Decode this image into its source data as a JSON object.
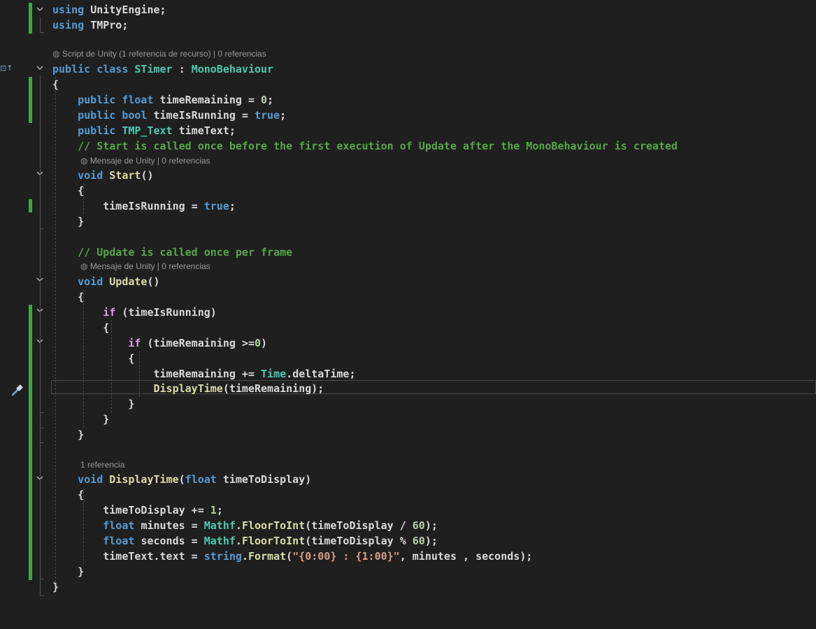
{
  "gutter": {
    "hierarchy_marker": "⊡↑"
  },
  "lenses": {
    "class_lens": "Script de Unity (1 referencia de recurso) | 0 referencias",
    "start_lens": "Mensaje de Unity | 0 referencias",
    "update_lens": "Mensaje de Unity | 0 referencias",
    "display_lens": "1 referencia"
  },
  "lines": {
    "l1": [
      [
        "using",
        "kw"
      ],
      [
        " ",
        "op"
      ],
      [
        "UnityEngine",
        "id"
      ],
      [
        ";",
        "op"
      ]
    ],
    "l2": [
      [
        "using",
        "kw"
      ],
      [
        " ",
        "op"
      ],
      [
        "TMPro",
        "id"
      ],
      [
        ";",
        "op"
      ]
    ],
    "l3": [
      [
        "public",
        "kw"
      ],
      [
        " ",
        "op"
      ],
      [
        "class",
        "kw"
      ],
      [
        " ",
        "op"
      ],
      [
        "STimer",
        "ty"
      ],
      [
        " : ",
        "op"
      ],
      [
        "MonoBehaviour",
        "ty"
      ]
    ],
    "l4": [
      [
        "{",
        "op"
      ]
    ],
    "l5": [
      [
        "    ",
        "op"
      ],
      [
        "public",
        "kw"
      ],
      [
        " ",
        "op"
      ],
      [
        "float",
        "kw"
      ],
      [
        " ",
        "op"
      ],
      [
        "timeRemaining",
        "id"
      ],
      [
        " = ",
        "op"
      ],
      [
        "0",
        "nm"
      ],
      [
        ";",
        "op"
      ]
    ],
    "l6": [
      [
        "    ",
        "op"
      ],
      [
        "public",
        "kw"
      ],
      [
        " ",
        "op"
      ],
      [
        "bool",
        "kw"
      ],
      [
        " ",
        "op"
      ],
      [
        "timeIsRunning",
        "id"
      ],
      [
        " = ",
        "op"
      ],
      [
        "true",
        "kw"
      ],
      [
        ";",
        "op"
      ]
    ],
    "l7": [
      [
        "    ",
        "op"
      ],
      [
        "public",
        "kw"
      ],
      [
        " ",
        "op"
      ],
      [
        "TMP_Text",
        "ty"
      ],
      [
        " ",
        "op"
      ],
      [
        "timeText",
        "id"
      ],
      [
        ";",
        "op"
      ]
    ],
    "l8": [
      [
        "    ",
        "op"
      ],
      [
        "// Start is called once before the first execution of Update after the MonoBehaviour is created",
        "cm"
      ]
    ],
    "l9": [
      [
        "    ",
        "op"
      ],
      [
        "void",
        "kw"
      ],
      [
        " ",
        "op"
      ],
      [
        "Start",
        "fn"
      ],
      [
        "()",
        "op"
      ]
    ],
    "l10": [
      [
        "    ",
        "op"
      ],
      [
        "{",
        "op"
      ]
    ],
    "l11": [
      [
        "        ",
        "op"
      ],
      [
        "timeIsRunning",
        "id"
      ],
      [
        " = ",
        "op"
      ],
      [
        "true",
        "kw"
      ],
      [
        ";",
        "op"
      ]
    ],
    "l12": [
      [
        "    ",
        "op"
      ],
      [
        "}",
        "op"
      ]
    ],
    "l13": [
      [
        "    ",
        "op"
      ],
      [
        "// Update is called once per frame",
        "cm"
      ]
    ],
    "l14": [
      [
        "    ",
        "op"
      ],
      [
        "void",
        "kw"
      ],
      [
        " ",
        "op"
      ],
      [
        "Update",
        "fn"
      ],
      [
        "()",
        "op"
      ]
    ],
    "l15": [
      [
        "    ",
        "op"
      ],
      [
        "{",
        "op"
      ]
    ],
    "l16": [
      [
        "        ",
        "op"
      ],
      [
        "if",
        "ct"
      ],
      [
        " (",
        "op"
      ],
      [
        "timeIsRunning",
        "id"
      ],
      [
        ")",
        "op"
      ]
    ],
    "l17": [
      [
        "        ",
        "op"
      ],
      [
        "{",
        "op"
      ]
    ],
    "l18": [
      [
        "            ",
        "op"
      ],
      [
        "if",
        "ct"
      ],
      [
        " (",
        "op"
      ],
      [
        "timeRemaining",
        "id"
      ],
      [
        " >=",
        "op"
      ],
      [
        "0",
        "nm"
      ],
      [
        ")",
        "op"
      ]
    ],
    "l19": [
      [
        "            ",
        "op"
      ],
      [
        "{",
        "op"
      ]
    ],
    "l20": [
      [
        "                ",
        "op"
      ],
      [
        "timeRemaining",
        "id"
      ],
      [
        " += ",
        "op"
      ],
      [
        "Time",
        "ty"
      ],
      [
        ".",
        "op"
      ],
      [
        "deltaTime",
        "id"
      ],
      [
        ";",
        "op"
      ]
    ],
    "l21": [
      [
        "                ",
        "op"
      ],
      [
        "DisplayTime",
        "fn"
      ],
      [
        "(",
        "op"
      ],
      [
        "timeRemaining",
        "id"
      ],
      [
        ");",
        "op"
      ]
    ],
    "l22": [
      [
        "            ",
        "op"
      ],
      [
        "}",
        "op"
      ]
    ],
    "l23": [
      [
        "        ",
        "op"
      ],
      [
        "}",
        "op"
      ]
    ],
    "l24": [
      [
        "    ",
        "op"
      ],
      [
        "}",
        "op"
      ]
    ],
    "l25": [
      [
        "    ",
        "op"
      ],
      [
        "void",
        "kw"
      ],
      [
        " ",
        "op"
      ],
      [
        "DisplayTime",
        "fn"
      ],
      [
        "(",
        "op"
      ],
      [
        "float",
        "kw"
      ],
      [
        " ",
        "op"
      ],
      [
        "timeToDisplay",
        "id"
      ],
      [
        ")",
        "op"
      ]
    ],
    "l26": [
      [
        "    ",
        "op"
      ],
      [
        "{",
        "op"
      ]
    ],
    "l27": [
      [
        "        ",
        "op"
      ],
      [
        "timeToDisplay",
        "id"
      ],
      [
        " += ",
        "op"
      ],
      [
        "1",
        "nm"
      ],
      [
        ";",
        "op"
      ]
    ],
    "l28": [
      [
        "        ",
        "op"
      ],
      [
        "float",
        "kw"
      ],
      [
        " ",
        "op"
      ],
      [
        "minutes",
        "id"
      ],
      [
        " = ",
        "op"
      ],
      [
        "Mathf",
        "ty"
      ],
      [
        ".",
        "op"
      ],
      [
        "FloorToInt",
        "fn"
      ],
      [
        "(",
        "op"
      ],
      [
        "timeToDisplay",
        "id"
      ],
      [
        " / ",
        "op"
      ],
      [
        "60",
        "nm"
      ],
      [
        ");",
        "op"
      ]
    ],
    "l29": [
      [
        "        ",
        "op"
      ],
      [
        "float",
        "kw"
      ],
      [
        " ",
        "op"
      ],
      [
        "seconds",
        "id"
      ],
      [
        " = ",
        "op"
      ],
      [
        "Mathf",
        "ty"
      ],
      [
        ".",
        "op"
      ],
      [
        "FloorToInt",
        "fn"
      ],
      [
        "(",
        "op"
      ],
      [
        "timeToDisplay",
        "id"
      ],
      [
        " % ",
        "op"
      ],
      [
        "60",
        "nm"
      ],
      [
        ");",
        "op"
      ]
    ],
    "l30": [
      [
        "        ",
        "op"
      ],
      [
        "timeText",
        "id"
      ],
      [
        ".",
        "op"
      ],
      [
        "text",
        "id"
      ],
      [
        " = ",
        "op"
      ],
      [
        "string",
        "kw"
      ],
      [
        ".",
        "op"
      ],
      [
        "Format",
        "fn"
      ],
      [
        "(",
        "op"
      ],
      [
        "\"{0:00} : {1:00}\"",
        "st"
      ],
      [
        ", ",
        "op"
      ],
      [
        "minutes",
        "id"
      ],
      [
        " , ",
        "op"
      ],
      [
        "seconds",
        "id"
      ],
      [
        ");",
        "op"
      ]
    ],
    "l31": [
      [
        "    ",
        "op"
      ],
      [
        "}",
        "op"
      ]
    ],
    "l32": [
      [
        "}",
        "op"
      ]
    ]
  },
  "colors": {
    "background": "#1f1f1f",
    "keyword": "#569cd6",
    "control": "#d8a0df",
    "type": "#4ec9b0",
    "method": "#dcdcaa",
    "identifier": "#dadada",
    "number": "#b5cea8",
    "string": "#d69d85",
    "comment": "#57a64a",
    "change_bar": "#3fa845"
  }
}
